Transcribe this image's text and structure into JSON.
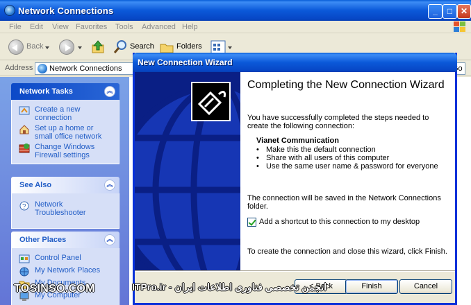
{
  "window": {
    "title": "Network Connections"
  },
  "menu": [
    "File",
    "Edit",
    "View",
    "Favorites",
    "Tools",
    "Advanced",
    "Help"
  ],
  "toolbar": {
    "back": "Back",
    "search": "Search",
    "folders": "Folders"
  },
  "address": {
    "label": "Address",
    "value": "Network Connections",
    "go": "Go"
  },
  "sidebar": {
    "network_tasks": {
      "title": "Network Tasks",
      "items": [
        {
          "label": "Create a new connection",
          "icon": "new-connection-icon"
        },
        {
          "label": "Set up a home or small office network",
          "icon": "home-network-icon"
        },
        {
          "label": "Change Windows Firewall settings",
          "icon": "firewall-icon"
        }
      ]
    },
    "see_also": {
      "title": "See Also",
      "items": [
        {
          "label": "Network Troubleshooter",
          "icon": "troubleshooter-icon"
        }
      ]
    },
    "other_places": {
      "title": "Other Places",
      "items": [
        {
          "label": "Control Panel",
          "icon": "control-panel-icon"
        },
        {
          "label": "My Network Places",
          "icon": "network-places-icon"
        },
        {
          "label": "My Documents",
          "icon": "documents-icon"
        },
        {
          "label": "My Computer",
          "icon": "computer-icon"
        }
      ]
    }
  },
  "wizard": {
    "title": "New Connection Wizard",
    "heading": "Completing the New Connection Wizard",
    "intro": "You have successfully completed the steps needed to create the following connection:",
    "connection_name": "Vianet Communication",
    "bullets": [
      "Make this the default connection",
      "Share with all users of this computer",
      "Use the same user name & password for everyone"
    ],
    "saved_note": "The connection will be saved in the Network Connections folder.",
    "shortcut_label": "Add a shortcut to this connection to my desktop",
    "shortcut_checked": true,
    "finish_note": "To create the connection and close this wizard, click Finish.",
    "buttons": {
      "back": "< Back",
      "finish": "Finish",
      "cancel": "Cancel"
    }
  },
  "watermark": {
    "left": "TOSINSO.COM",
    "right": "انجمن تخصصی فناوری اطلاعات ایران - ITPro.ir"
  },
  "colors": {
    "xp_blue": "#0b59d9",
    "taskpane_bg": "#7ba2e7",
    "wizard_side": "#0a1f85",
    "link": "#215dc6"
  }
}
